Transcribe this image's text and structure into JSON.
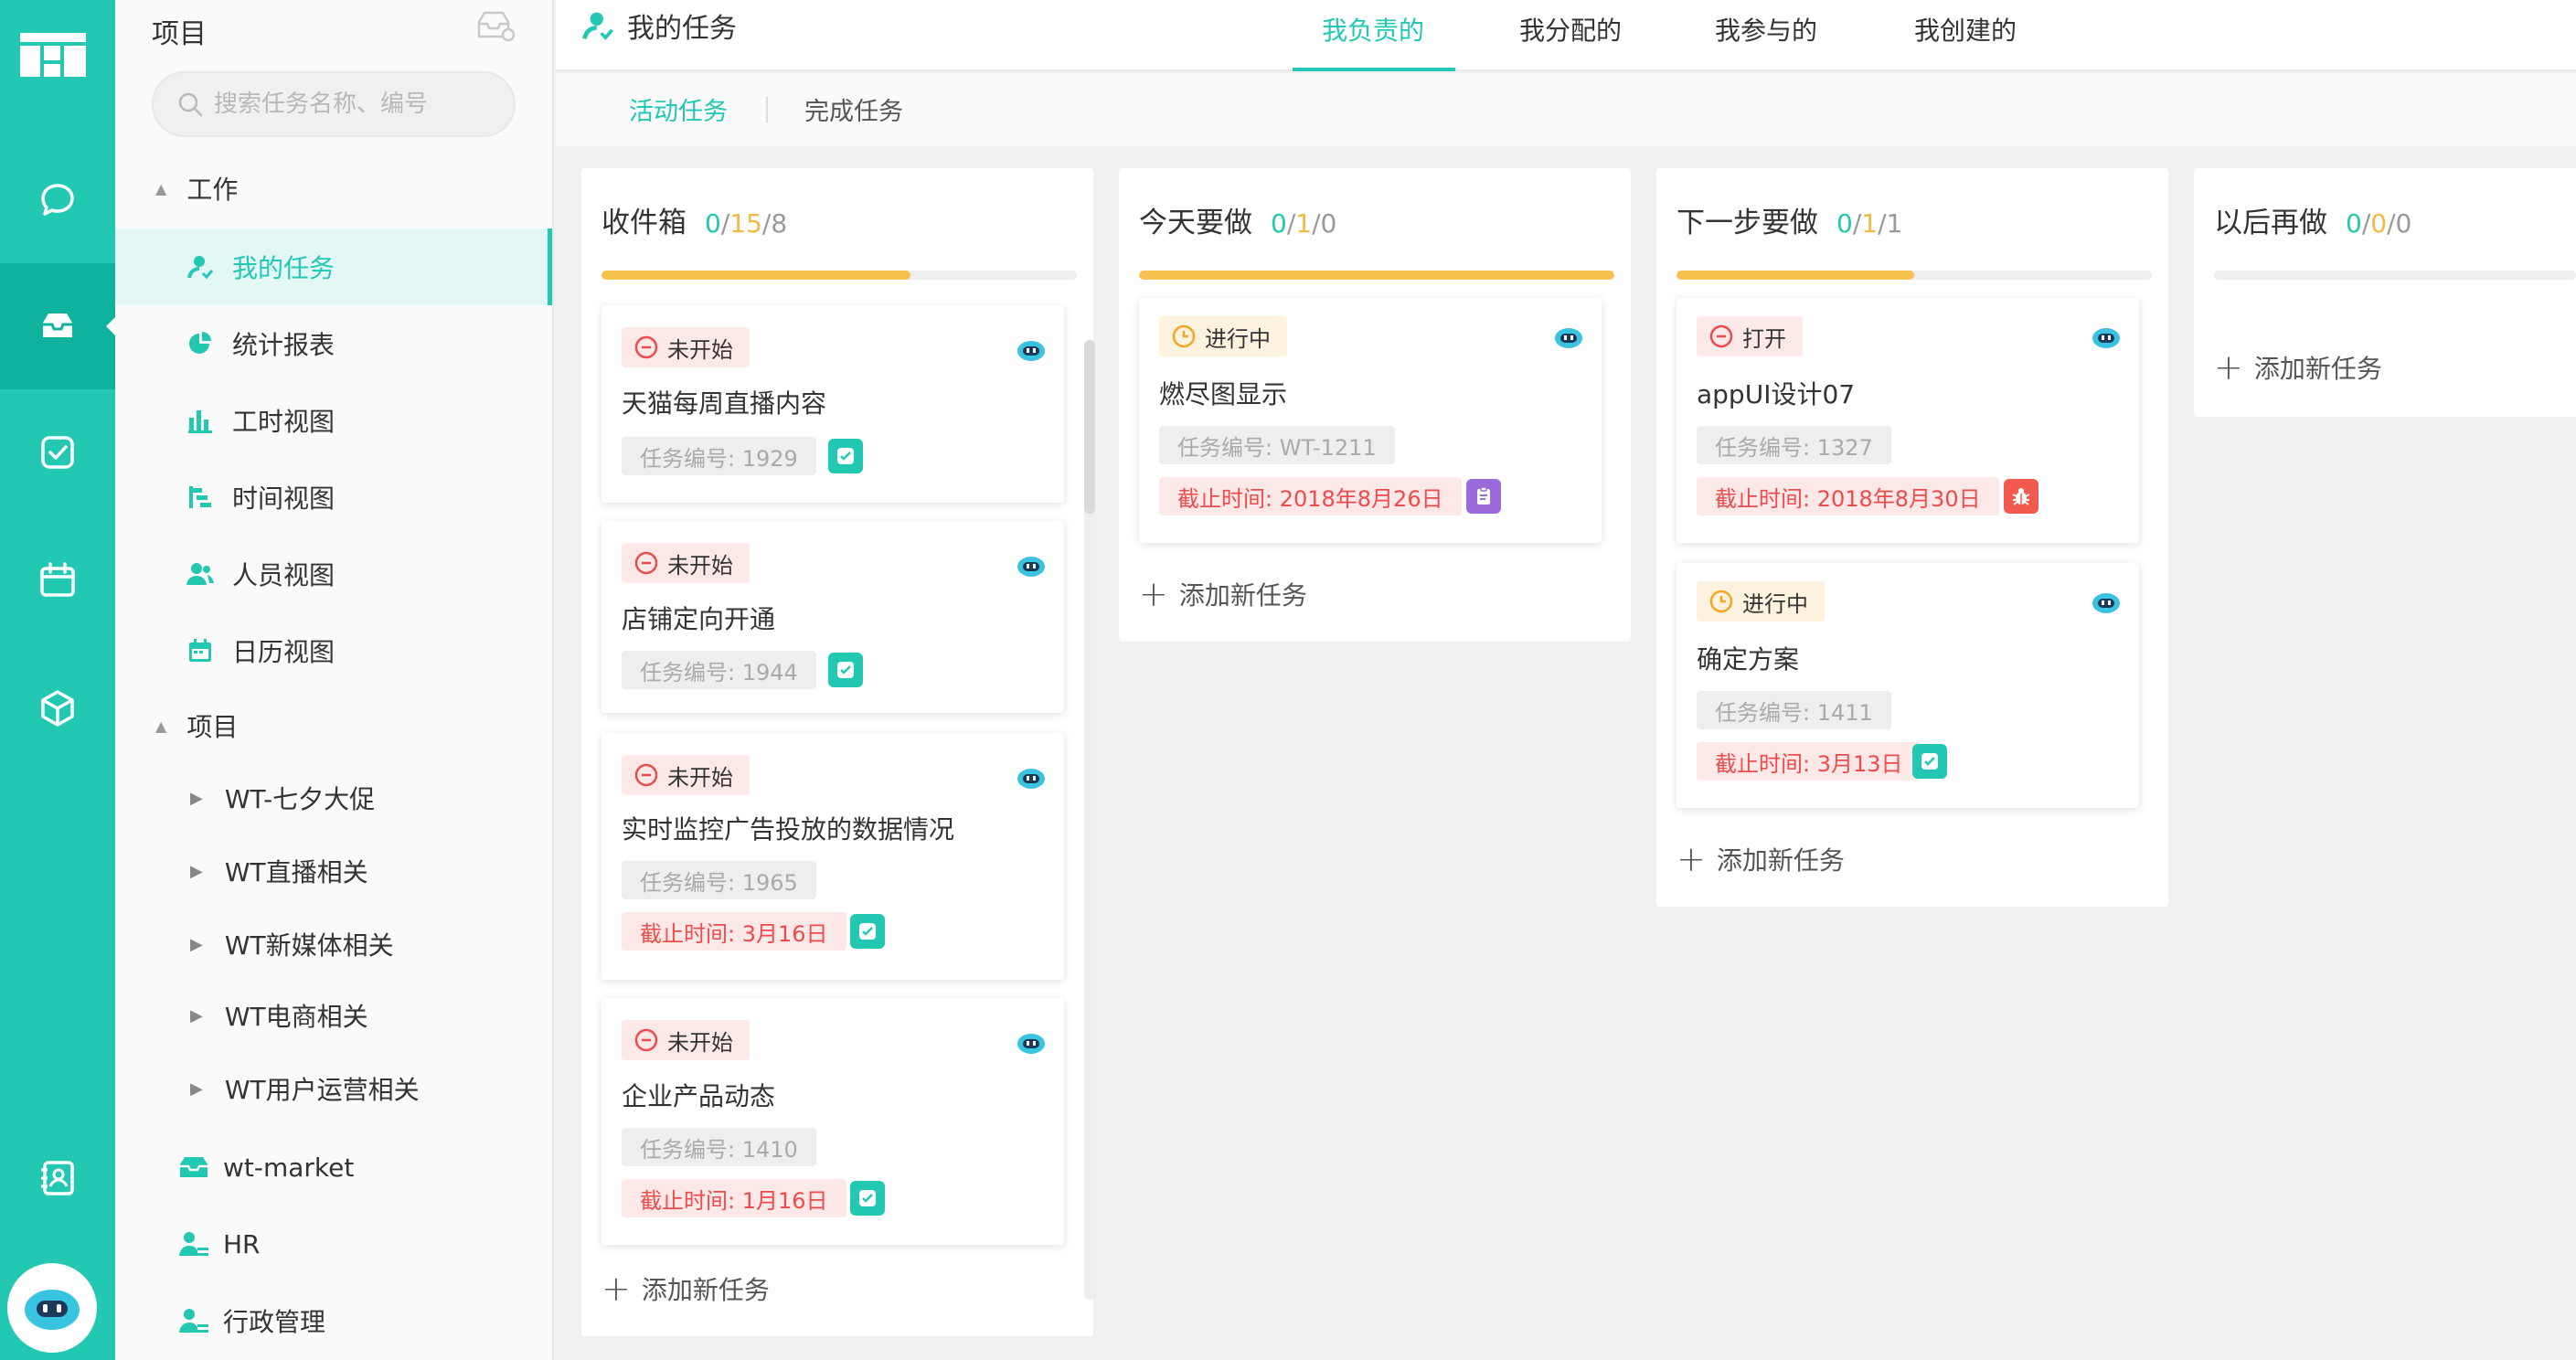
{
  "colors": {
    "accent": "#22c8b2",
    "rail_active": "#0fb29d",
    "warning": "#f5b942",
    "danger": "#ee4b4b"
  },
  "rail": {
    "items": [
      "logo-icon",
      "chat-icon",
      "inbox-icon",
      "check-icon",
      "calendar-icon",
      "cube-icon",
      "contacts-icon",
      "robot-avatar"
    ],
    "active": "inbox-icon"
  },
  "sidebar": {
    "title": "项目",
    "search_placeholder": "搜索任务名称、编号",
    "work_group": "工作",
    "work_items": [
      {
        "label": "我的任务",
        "icon": "user-icon",
        "active": true
      },
      {
        "label": "统计报表",
        "icon": "pie-chart-icon"
      },
      {
        "label": "工时视图",
        "icon": "bar-chart-icon"
      },
      {
        "label": "时间视图",
        "icon": "gantt-icon"
      },
      {
        "label": "人员视图",
        "icon": "users-icon"
      },
      {
        "label": "日历视图",
        "icon": "calendar-icon"
      }
    ],
    "project_group": "项目",
    "projects": [
      {
        "label": "WT-七夕大促"
      },
      {
        "label": "WT直播相关"
      },
      {
        "label": "WT新媒体相关"
      },
      {
        "label": "WT电商相关"
      },
      {
        "label": "WT用户运营相关"
      }
    ],
    "teams": [
      {
        "label": "wt-market",
        "icon": "tray-icon"
      },
      {
        "label": "HR",
        "icon": "team-icon"
      },
      {
        "label": "行政管理",
        "icon": "team-icon"
      }
    ]
  },
  "header": {
    "title": "我的任务",
    "tabs": [
      {
        "label": "我负责的",
        "active": true
      },
      {
        "label": "我分配的"
      },
      {
        "label": "我参与的"
      },
      {
        "label": "我创建的"
      }
    ]
  },
  "subtabs": [
    {
      "label": "活动任务",
      "active": true
    },
    {
      "label": "完成任务"
    }
  ],
  "add_task_label": "添加新任务",
  "columns": [
    {
      "title": "收件箱",
      "done": "0",
      "doing": "15",
      "todo": "8",
      "progress": 0.65,
      "cards": [
        {
          "status": "未开始",
          "status_type": "notstart",
          "title": "天猫每周直播内容",
          "code": "任务编号: 1929",
          "due": "",
          "badge": "teal"
        },
        {
          "status": "未开始",
          "status_type": "notstart",
          "title": "店铺定向开通",
          "code": "任务编号: 1944",
          "due": "",
          "badge": "teal"
        },
        {
          "status": "未开始",
          "status_type": "notstart",
          "title": "实时监控广告投放的数据情况",
          "code": "任务编号: 1965",
          "due": "截止时间: 3月16日",
          "badge": "teal"
        },
        {
          "status": "未开始",
          "status_type": "notstart",
          "title": "企业产品动态",
          "code": "任务编号: 1410",
          "due": "截止时间: 1月16日",
          "badge": "teal"
        }
      ]
    },
    {
      "title": "今天要做",
      "done": "0",
      "doing": "1",
      "todo": "0",
      "progress": 1.0,
      "cards": [
        {
          "status": "进行中",
          "status_type": "doing",
          "title": "燃尽图显示",
          "code": "任务编号: WT-1211",
          "due": "截止时间: 2018年8月26日",
          "badge": "purple"
        }
      ]
    },
    {
      "title": "下一步要做",
      "done": "0",
      "doing": "1",
      "todo": "1",
      "progress": 0.5,
      "cards": [
        {
          "status": "打开",
          "status_type": "open",
          "title": "appUI设计07",
          "code": "任务编号: 1327",
          "due": "截止时间: 2018年8月30日",
          "badge": "red"
        },
        {
          "status": "进行中",
          "status_type": "doing",
          "title": "确定方案",
          "code": "任务编号: 1411",
          "due": "截止时间: 3月13日",
          "badge": "teal"
        }
      ]
    },
    {
      "title": "以后再做",
      "done": "0",
      "doing": "0",
      "todo": "0",
      "progress": 0.0,
      "cards": []
    }
  ]
}
